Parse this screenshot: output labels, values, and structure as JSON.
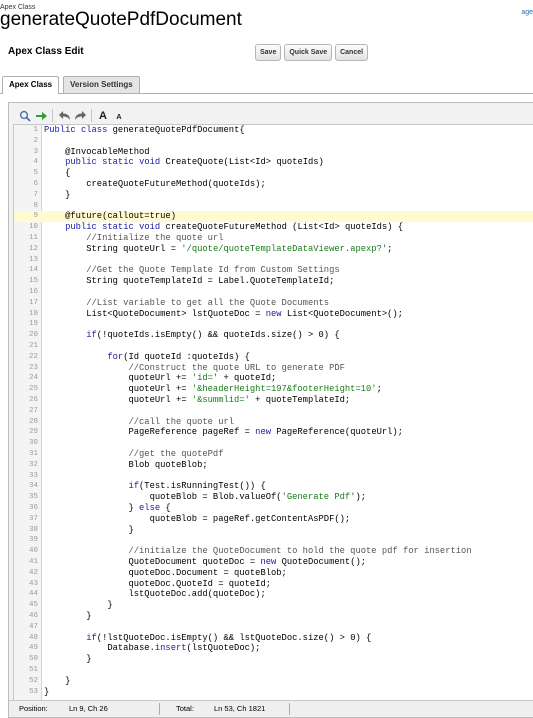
{
  "header": {
    "object_type": "Apex Class",
    "title": "generateQuotePdfDocument",
    "help_link": "age"
  },
  "edit": {
    "title": "Apex Class Edit",
    "buttons": {
      "save": "Save",
      "quick_save": "Quick Save",
      "cancel": "Cancel"
    }
  },
  "tabs": [
    {
      "label": "Apex Class",
      "active": true
    },
    {
      "label": "Version Settings",
      "active": false
    }
  ],
  "toolbar": {
    "icons": [
      "search-icon",
      "go-to-line-icon",
      "undo-icon",
      "redo-icon",
      "font-larger-icon",
      "font-smaller-icon"
    ],
    "font_larger": "A",
    "font_smaller": "A"
  },
  "editor": {
    "highlight_line": 9,
    "lines": [
      "Public class generateQuotePdfDocument{",
      "",
      "    @InvocableMethod",
      "    public static void CreateQuote(List<Id> quoteIds)",
      "    {",
      "        createQuoteFutureMethod(quoteIds);",
      "    }",
      "",
      "    @future(callout=true)",
      "    public static void createQuoteFutureMethod (List<Id> quoteIds) {",
      "        //Initialize the quote url",
      "        String quoteUrl = '/quote/quoteTemplateDataViewer.apexp?';",
      "",
      "        //Get the Quote Template Id from Custom Settings",
      "        String quoteTemplateId = Label.QuoteTemplateId;",
      "",
      "        //List variable to get all the Quote Documents",
      "        List<QuoteDocument> lstQuoteDoc = new List<QuoteDocument>();",
      "",
      "        if(!quoteIds.isEmpty() && quoteIds.size() > 0) {",
      "",
      "            for(Id quoteId :quoteIds) {",
      "                //Construct the quote URL to generate PDF",
      "                quoteUrl += 'id=' + quoteId;",
      "                quoteUrl += '&headerHeight=197&footerHeight=10';",
      "                quoteUrl += '&summlid=' + quoteTemplateId;",
      "",
      "                //call the quote url",
      "                PageReference pageRef = new PageReference(quoteUrl);",
      "",
      "                //get the quotePdf",
      "                Blob quoteBlob;",
      "",
      "                if(Test.isRunningTest()) {",
      "                    quoteBlob = Blob.valueOf('Generate Pdf');",
      "                } else {",
      "                    quoteBlob = pageRef.getContentAsPDF();",
      "                }",
      "",
      "                //initialze the QuoteDocument to hold the quote pdf for insertion",
      "                QuoteDocument quoteDoc = new QuoteDocument();",
      "                quoteDoc.Document = quoteBlob;",
      "                quoteDoc.QuoteId = quoteId;",
      "                lstQuoteDoc.add(quoteDoc);",
      "            }",
      "        }",
      "",
      "        if(!lstQuoteDoc.isEmpty() && lstQuoteDoc.size() > 0) {",
      "            Database.insert(lstQuoteDoc);",
      "        }",
      "",
      "    }",
      "}"
    ]
  },
  "status": {
    "position_label": "Position:",
    "position_value": "Ln 9, Ch 26",
    "total_label": "Total:",
    "total_value": "Ln 53, Ch 1821"
  }
}
